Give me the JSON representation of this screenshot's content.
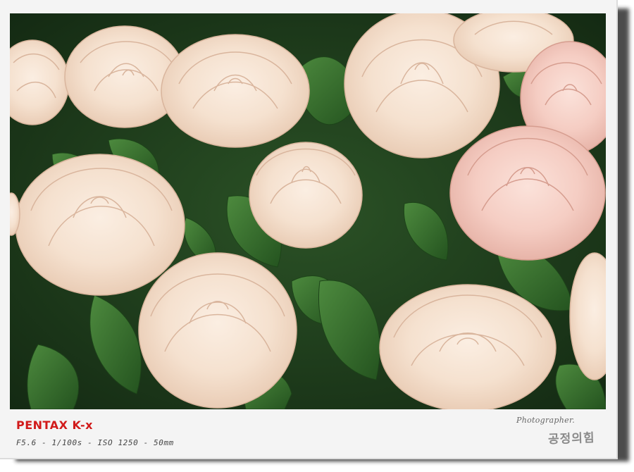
{
  "camera": {
    "brand": "PENTAX K-x",
    "settings": "F5.6 - 1/100s - ISO 1250 - 50mm"
  },
  "credit": {
    "label": "Photographer.",
    "name": "공정의힘"
  },
  "photo": {
    "subject": "pale pink and cream roses with green leaves",
    "colors": {
      "rose_cream": "#f7e6d6",
      "rose_pink": "#f6cfc6",
      "leaf": "#2f6a2a",
      "background": "#1f3a1c",
      "frame": "#f4f4f4",
      "brand_red": "#d11a1a"
    }
  }
}
